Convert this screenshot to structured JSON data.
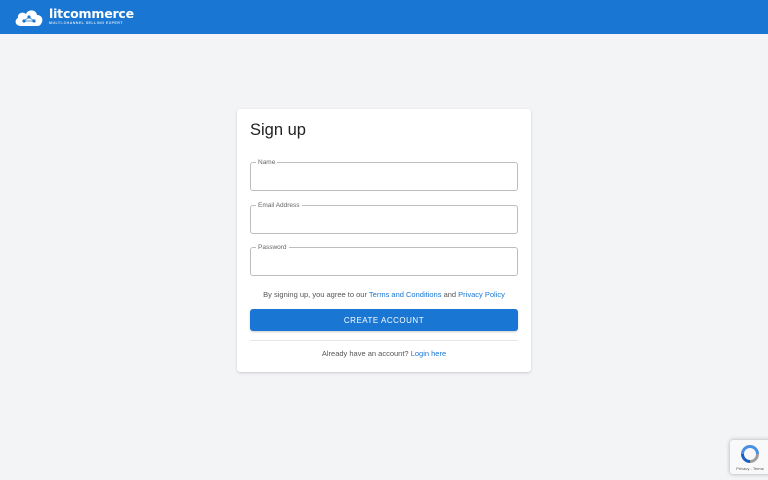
{
  "header": {
    "brand_name": "litcommerce",
    "brand_tagline": "MULTI-CHANNEL SELLING EXPERT",
    "logo_icon": "cloud-network-icon",
    "background_color": "#1976d2"
  },
  "signup": {
    "title": "Sign up",
    "fields": {
      "name": {
        "label": "Name",
        "value": "",
        "placeholder": ""
      },
      "email": {
        "label": "Email Address",
        "value": "",
        "placeholder": ""
      },
      "password": {
        "label": "Password",
        "value": "",
        "placeholder": ""
      }
    },
    "terms": {
      "prefix": "By signing up, you agree to our",
      "terms_link": "Terms and Conditions",
      "and": "and",
      "privacy_link": "Privacy Policy"
    },
    "create_button": "CREATE ACCOUNT",
    "login_prompt": "Already have an account?",
    "login_link": "Login here"
  },
  "recaptcha": {
    "icon": "recaptcha-icon",
    "privacy": "Privacy",
    "separator": "-",
    "terms": "Terms"
  },
  "colors": {
    "accent": "#1976d2",
    "page_background": "#f3f4f6"
  }
}
